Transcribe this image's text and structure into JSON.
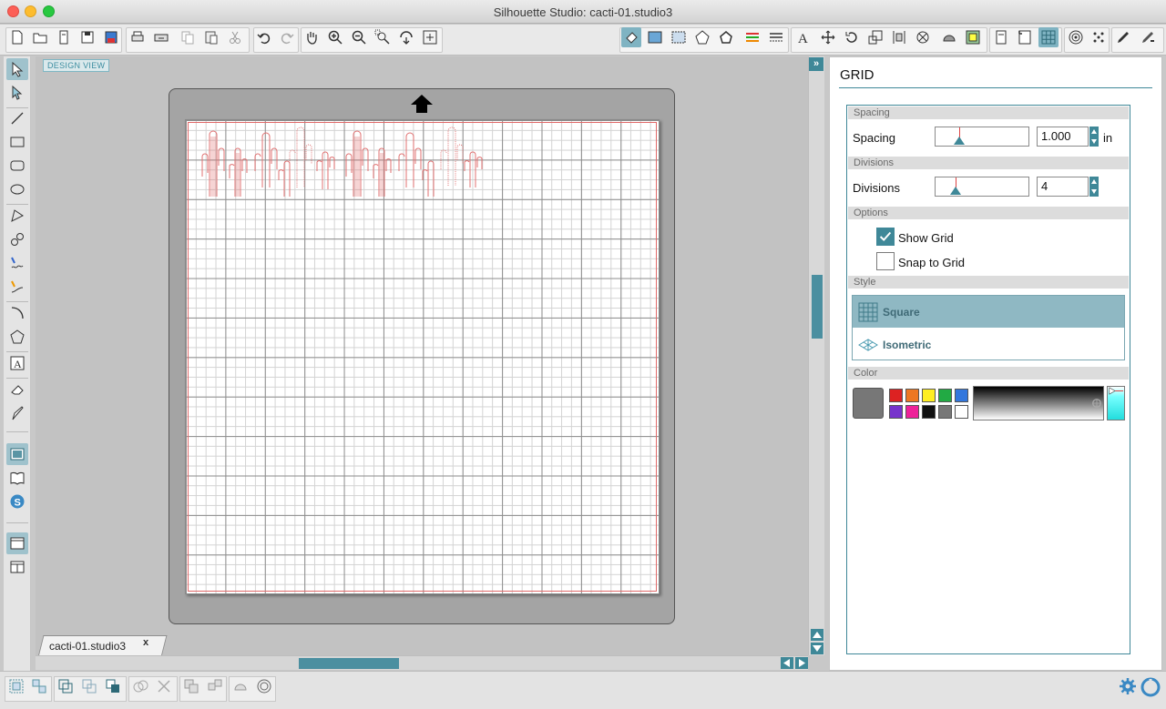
{
  "window": {
    "title": "Silhouette Studio: cacti-01.studio3"
  },
  "workspace": {
    "view_label": "DESIGN VIEW",
    "document_tab": "cacti-01.studio3",
    "tab_close": "x"
  },
  "panel": {
    "title": "GRID",
    "sections": {
      "spacing": "Spacing",
      "divisions": "Divisions",
      "options": "Options",
      "style": "Style",
      "color": "Color"
    },
    "spacing": {
      "label": "Spacing",
      "value": "1.000",
      "unit": "in"
    },
    "divisions": {
      "label": "Divisions",
      "value": "4"
    },
    "options": {
      "show_grid": {
        "label": "Show Grid",
        "checked": true
      },
      "snap_to_grid": {
        "label": "Snap to Grid",
        "checked": false
      }
    },
    "style": {
      "options": [
        "Square",
        "Isometric"
      ],
      "selected": "Square"
    },
    "color": {
      "current": "#777777",
      "swatches": [
        "#dd2222",
        "#ee7722",
        "#ffee22",
        "#22aa44",
        "#3377dd",
        "#7733cc",
        "#ee2299",
        "#111111",
        "#777777",
        "#ffffff"
      ]
    }
  },
  "colors": {
    "accent": "#3f8898",
    "cut_line": "#e06a6a"
  }
}
